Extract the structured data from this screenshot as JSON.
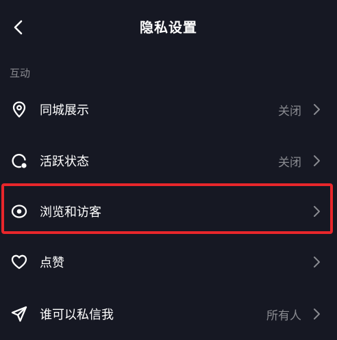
{
  "header": {
    "title": "隐私设置",
    "back_icon": "chevron-left-icon"
  },
  "section": {
    "label": "互动"
  },
  "items": [
    {
      "label": "同城展示",
      "value": "关闭",
      "icon": "location-pin-icon"
    },
    {
      "label": "活跃状态",
      "value": "关闭",
      "icon": "active-status-icon"
    },
    {
      "label": "浏览和访客",
      "value": "",
      "icon": "eye-icon"
    },
    {
      "label": "点赞",
      "value": "",
      "icon": "heart-icon"
    },
    {
      "label": "谁可以私信我",
      "value": "所有人",
      "icon": "send-icon"
    }
  ],
  "colors": {
    "background": "#161823",
    "text": "#ffffff",
    "muted": "#8a8b91",
    "highlight": "#e8262b"
  }
}
